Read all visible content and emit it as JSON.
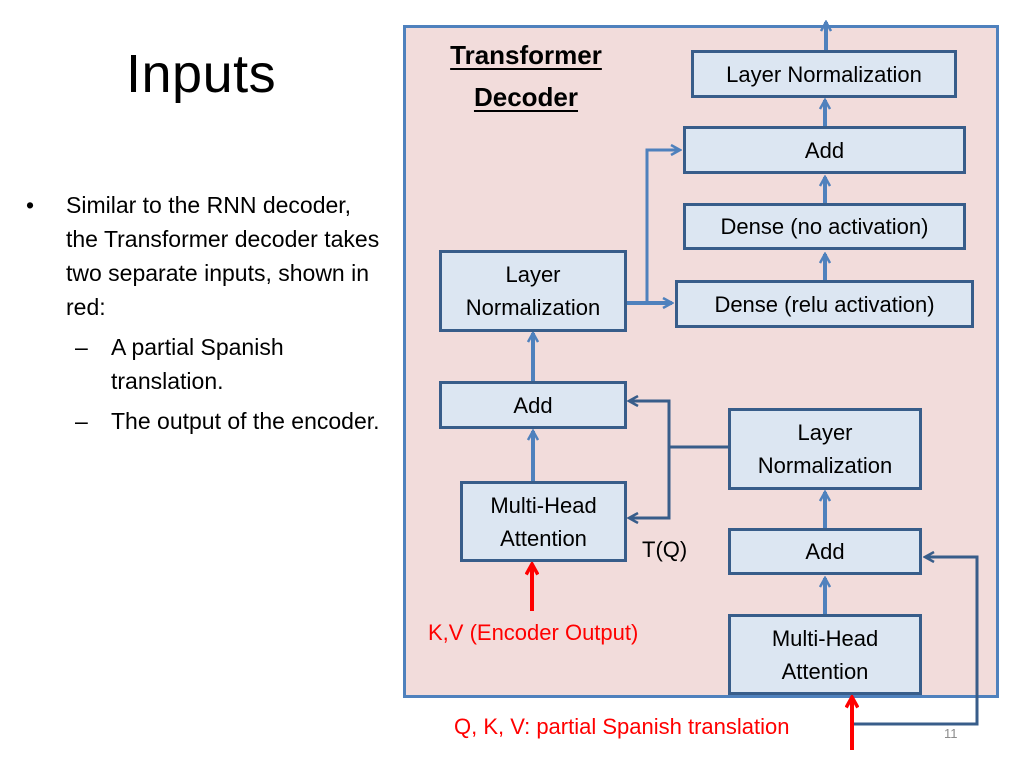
{
  "slide": {
    "title": "Inputs",
    "bullets": [
      {
        "marker": "•",
        "text": "Similar to the RNN decoder, the Transformer decoder takes two separate inputs, shown in red:",
        "sub_items": [
          {
            "marker": "–",
            "text": "A partial Spanish translation."
          },
          {
            "marker": "–",
            "text": "The output of the encoder."
          }
        ]
      }
    ],
    "page_number": "11"
  },
  "diagram": {
    "title_line1": "Transformer",
    "title_line2": "Decoder",
    "boxes": {
      "top_layer_norm": "Layer Normalization",
      "top_add": "Add",
      "dense_no_act": "Dense (no activation)",
      "dense_relu": "Dense (relu activation)",
      "mid_layer_norm": "Layer Normalization",
      "mid_add": "Add",
      "cross_attention": "Multi-Head Attention",
      "self_layer_norm": "Layer Normalization",
      "self_add": "Add",
      "self_attention": "Multi-Head Attention"
    },
    "labels": {
      "tq": "T(Q)",
      "encoder_input": "K,V (Encoder Output)",
      "decoder_input": "Q, K, V: partial Spanish translation"
    },
    "colors": {
      "frame_fill": "#f2dcdb",
      "frame_border": "#4f81bd",
      "box_fill": "#dce6f2",
      "box_border": "#385d8a",
      "arrow": "#4f81bd",
      "input_red": "#ff0000"
    }
  }
}
